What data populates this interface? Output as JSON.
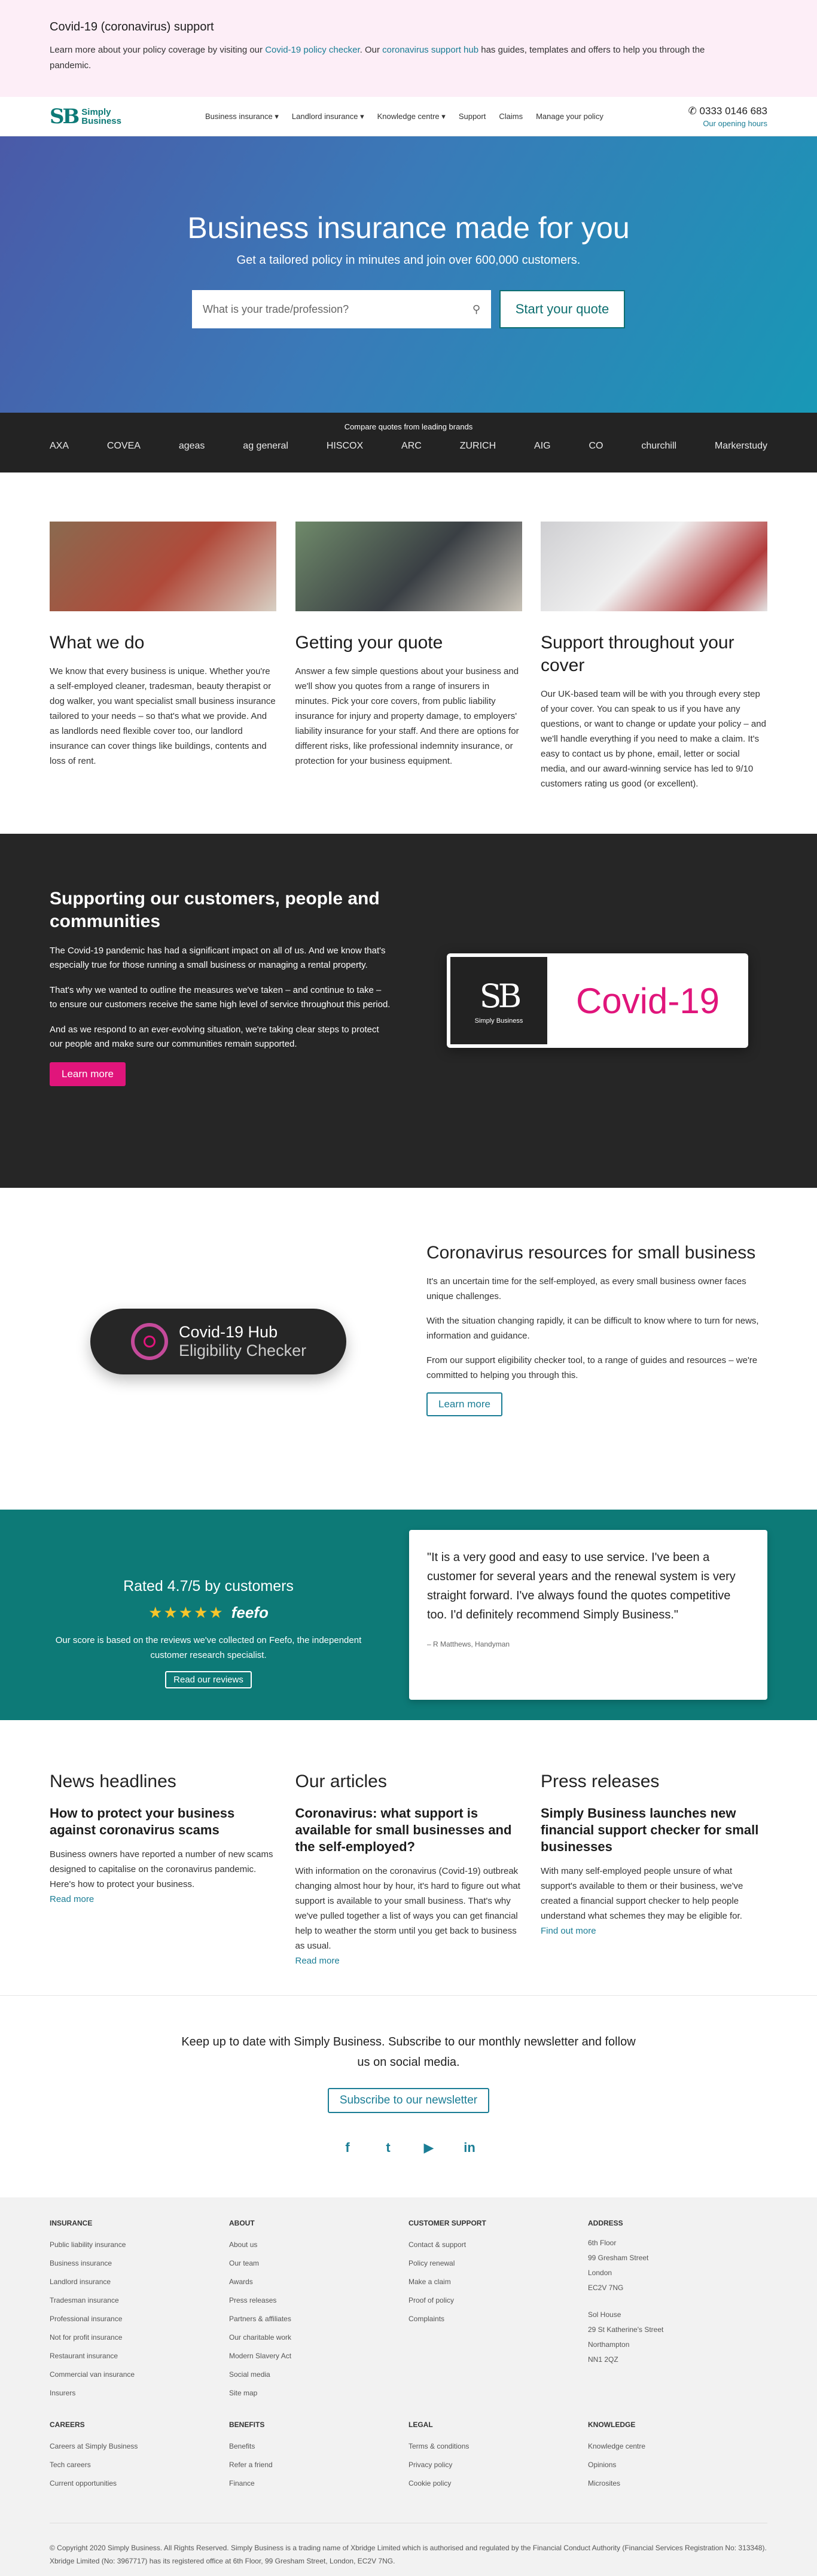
{
  "banner": {
    "title": "Covid-19 (coronavirus) support",
    "text_1": "Learn more about your policy coverage by visiting our ",
    "link_1": "Covid-19 policy checker",
    "text_2": ". Our ",
    "link_2": "coronavirus support hub",
    "text_3": " has guides, templates and offers to help you through the pandemic."
  },
  "header": {
    "logo_mark": "SB",
    "logo_line1": "Simply",
    "logo_line2": "Business",
    "nav": [
      "Business insurance ▾",
      "Landlord insurance ▾",
      "Knowledge centre ▾",
      "Support",
      "Claims",
      "Manage your policy"
    ],
    "phone": "0333 0146 683",
    "hours": "Our opening hours"
  },
  "hero": {
    "title": "Business insurance made for you",
    "subtitle": "Get a tailored policy in minutes and join over 600,000 customers.",
    "search_placeholder": "What is your trade/profession?",
    "cta": "Start your quote"
  },
  "brands": {
    "label": "Compare quotes from leading brands",
    "items": [
      "AXA",
      "COVEA",
      "ageas",
      "ag general",
      "HISCOX",
      "ARC",
      "ZURICH",
      "AIG",
      "CO",
      "churchill",
      "Markerstudy"
    ]
  },
  "features": [
    {
      "title": "What we do",
      "text": "We know that every business is unique. Whether you're a self-employed cleaner, tradesman, beauty therapist or dog walker, you want specialist small business insurance tailored to your needs – so that's what we provide. And as landlords need flexible cover too, our landlord insurance can cover things like buildings, contents and loss of rent."
    },
    {
      "title": "Getting your quote",
      "text": "Answer a few simple questions about your business and we'll show you quotes from a range of insurers in minutes. Pick your core covers, from public liability insurance for injury and property damage, to employers' liability insurance for your staff. And there are options for different risks, like professional indemnity insurance, or protection for your business equipment."
    },
    {
      "title": "Support throughout your cover",
      "text": "Our UK-based team will be with you through every step of your cover. You can speak to us if you have any questions, or want to change or update your policy – and we'll handle everything if you need to make a claim. It's easy to contact us by phone, email, letter or social media, and our award-winning service has led to 9/10 customers rating us good (or excellent)."
    }
  ],
  "dark": {
    "title": "Supporting our customers, people and communities",
    "p1": "The Covid-19 pandemic has had a significant impact on all of us. And we know that's especially true for those running a small business or managing a rental property.",
    "p2": "That's why we wanted to outline the measures we've taken – and continue to take – to ensure our customers receive the same high level of service throughout this period.",
    "p3": "And as we respond to an ever-evolving situation, we're taking clear steps to protect our people and make sure our communities remain supported.",
    "cta": "Learn more",
    "card_mark": "SB",
    "card_brand": "Simply Business",
    "card_text": "Covid-19"
  },
  "resources": {
    "pill_line1": "Covid-19 Hub",
    "pill_line2": "Eligibility Checker",
    "title": "Coronavirus resources for small business",
    "p1": "It's an uncertain time for the self-employed, as every small business owner faces unique challenges.",
    "p2": "With the situation changing rapidly, it can be difficult to know where to turn for news, information and guidance.",
    "p3": "From our support eligibility checker tool, to a range of guides and resources – we're committed to helping you through this.",
    "cta": "Learn more"
  },
  "ratings": {
    "title": "Rated 4.7/5 by customers",
    "stars": "★★★★★",
    "feefo": "feefo",
    "text": "Our score is based on the reviews we've collected on Feefo, the independent customer research specialist.",
    "cta": "Read our reviews",
    "quote": "\"It is a very good and easy to use service. I've been a customer for several years and the renewal system is very straight forward. I've always found the quotes competitive too. I'd definitely recommend Simply Business.\"",
    "author": "– R Matthews, Handyman"
  },
  "news": [
    {
      "heading": "News headlines",
      "title": "How to protect your business against coronavirus scams",
      "text": "Business owners have reported a number of new scams designed to capitalise on the coronavirus pandemic. Here's how to protect your business.",
      "link": "Read more"
    },
    {
      "heading": "Our articles",
      "title": "Coronavirus: what support is available for small businesses and the self-employed?",
      "text": "With information on the coronavirus (Covid-19) outbreak changing almost hour by hour, it's hard to figure out what support is available to your small business. That's why we've pulled together a list of ways you can get financial help to weather the storm until you get back to business as usual.",
      "link": "Read more"
    },
    {
      "heading": "Press releases",
      "title": "Simply Business launches new financial support checker for small businesses",
      "text": "With many self-employed people unsure of what support's available to them or their business, we've created a financial support checker to help people understand what schemes they may be eligible for.",
      "link": "Find out more"
    }
  ],
  "newsletter": {
    "text": "Keep up to date with Simply Business. Subscribe to our monthly newsletter and follow us on social media.",
    "cta": "Subscribe to our newsletter",
    "social": [
      "f",
      "t",
      "▶",
      "in"
    ]
  },
  "footer": {
    "insurance": {
      "title": "INSURANCE",
      "items": [
        "Public liability insurance",
        "Business insurance",
        "Landlord insurance",
        "Tradesman insurance",
        "Professional insurance",
        "Not for profit insurance",
        "Restaurant insurance",
        "Commercial van insurance",
        "Insurers"
      ]
    },
    "about": {
      "title": "ABOUT",
      "items": [
        "About us",
        "Our team",
        "Awards",
        "Press releases",
        "Partners & affiliates",
        "Our charitable work",
        "Modern Slavery Act",
        "Social media",
        "Site map"
      ]
    },
    "support": {
      "title": "CUSTOMER SUPPORT",
      "items": [
        "Contact & support",
        "Policy renewal",
        "Make a claim",
        "Proof of policy",
        "Complaints"
      ]
    },
    "address": {
      "title": "ADDRESS",
      "lines1": [
        "6th Floor",
        "99 Gresham Street",
        "London",
        "EC2V 7NG"
      ],
      "lines2": [
        "Sol House",
        "29 St Katherine's Street",
        "Northampton",
        "NN1 2QZ"
      ]
    },
    "careers": {
      "title": "CAREERS",
      "items": [
        "Careers at Simply Business",
        "Tech careers",
        "Current opportunities"
      ]
    },
    "benefits": {
      "title": "BENEFITS",
      "items": [
        "Benefits",
        "Refer a friend",
        "Finance"
      ]
    },
    "legal": {
      "title": "LEGAL",
      "items": [
        "Terms & conditions",
        "Privacy policy",
        "Cookie policy"
      ]
    },
    "knowledge": {
      "title": "KNOWLEDGE",
      "items": [
        "Knowledge centre",
        "Opinions",
        "Microsites"
      ]
    },
    "copyright": "© Copyright 2020 Simply Business. All Rights Reserved. Simply Business is a trading name of Xbridge Limited which is authorised and regulated by the Financial Conduct Authority (Financial Services Registration No: 313348). Xbridge Limited (No: 3967717) has its registered office at 6th Floor, 99 Gresham Street, London, EC2V 7NG."
  },
  "colors": {
    "teal": "#0d7a77",
    "link": "#1a7d95",
    "pink": "#e0157b",
    "dark": "#262626"
  }
}
